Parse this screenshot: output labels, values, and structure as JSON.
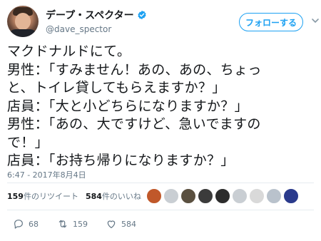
{
  "user": {
    "display_name": "デープ・スペクター",
    "handle": "@dave_spector",
    "verified": true
  },
  "follow_button": {
    "label": "フォローする"
  },
  "tweet": {
    "lines": [
      "マクドナルドにて。",
      "男性：「すみません！あの、あの、ちょっ",
      "と、トイレ貸してもらえますか？」",
      "店員：「大と小どちらになりますか？」",
      "男性：「あの、大ですけど、急いでますの",
      "で！」",
      "店員：「お持ち帰りになりますか？」"
    ],
    "timestamp": "6:47 - 2017年8月4日"
  },
  "stats": {
    "retweets_count": "159",
    "retweets_label": "件のリツイート",
    "likes_count": "584",
    "likes_label": "件のいいね"
  },
  "actions": {
    "reply_count": "68",
    "retweet_count": "159",
    "like_count": "584"
  },
  "colors": {
    "accent": "#1da1f2",
    "text": "#14171a",
    "muted": "#657786",
    "divider": "#e6ecf0"
  },
  "likers": [
    {
      "icon": "liker-avatar",
      "color": "#c0582a"
    },
    {
      "icon": "liker-avatar",
      "color": "#c9ced3"
    },
    {
      "icon": "liker-avatar",
      "color": "#5a5040"
    },
    {
      "icon": "liker-avatar",
      "color": "#3b3b3b"
    },
    {
      "icon": "liker-avatar",
      "color": "#2c2c2c"
    },
    {
      "icon": "liker-avatar",
      "color": "#c9ced3"
    },
    {
      "icon": "liker-avatar",
      "color": "#d9d9d9"
    },
    {
      "icon": "liker-avatar",
      "color": "#b9c2cc"
    },
    {
      "icon": "liker-avatar",
      "color": "#2a3a8c"
    }
  ]
}
